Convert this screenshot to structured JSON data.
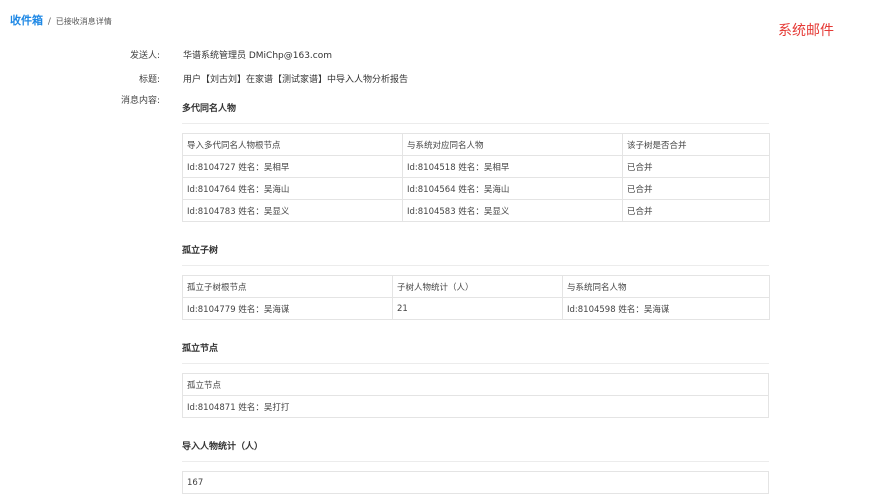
{
  "breadcrumb": {
    "root": "收件箱",
    "separator": "/",
    "current": "已接收消息详情"
  },
  "header": {
    "title": "系统邮件"
  },
  "meta": {
    "sender_label": "发送人:",
    "sender_value": "华谱系统管理员 DMiChp@163.com",
    "subject_label": "标题:",
    "subject_value": "用户【刘古刘】在家谱【测试家谱】中导入人物分析报告",
    "content_label": "消息内容:"
  },
  "sections": {
    "multi": {
      "title": "多代同名人物",
      "headers": [
        "导入多代同名人物根节点",
        "与系统对应同名人物",
        "该子树是否合并"
      ],
      "rows": [
        [
          "Id:8104727 姓名：吴相早",
          "Id:8104518 姓名：吴相早",
          "已合并"
        ],
        [
          "Id:8104764 姓名：吴海山",
          "Id:8104564 姓名：吴海山",
          "已合并"
        ],
        [
          "Id:8104783 姓名：吴显义",
          "Id:8104583 姓名：吴显义",
          "已合并"
        ]
      ]
    },
    "isolated_tree": {
      "title": "孤立子树",
      "headers": [
        "孤立子树根节点",
        "子树人物统计（人）",
        "与系统同名人物"
      ],
      "rows": [
        [
          "Id:8104779 姓名：吴海谋",
          "21",
          "Id:8104598 姓名：吴海谋"
        ]
      ]
    },
    "isolated_node": {
      "title": "孤立节点",
      "headers": [
        "孤立节点"
      ],
      "rows": [
        [
          "Id:8104871 姓名：吴打打"
        ]
      ]
    },
    "stats": {
      "title": "导入人物统计（人）",
      "value": "167"
    }
  }
}
